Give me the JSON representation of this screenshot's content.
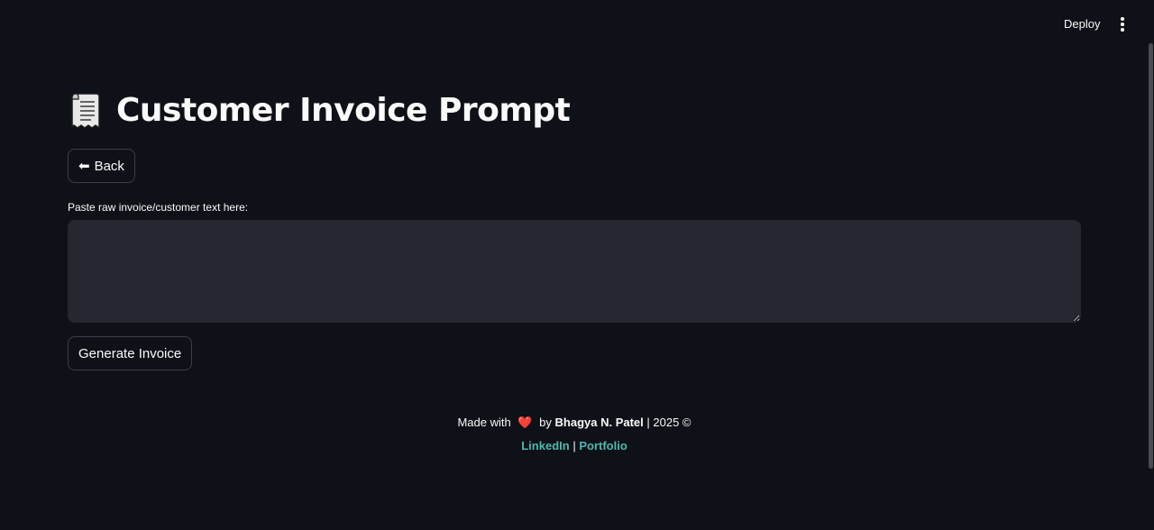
{
  "toolbar": {
    "deploy_label": "Deploy",
    "menu_icon": "more-vertical-icon"
  },
  "header": {
    "icon": "receipt-icon",
    "title": "Customer Invoice Prompt"
  },
  "back_button": {
    "arrow": "⬅",
    "label": "Back"
  },
  "invoice_input": {
    "label": "Paste raw invoice/customer text here:",
    "value": "",
    "placeholder": ""
  },
  "generate_button": {
    "label": "Generate Invoice"
  },
  "footer": {
    "made_with": "Made with",
    "heart": "❤️",
    "by": "by",
    "author": "Bhagya N. Patel",
    "year_text": "| 2025 ©",
    "links": [
      {
        "label": "LinkedIn"
      },
      {
        "label": "Portfolio"
      }
    ],
    "separator": "|"
  },
  "colors": {
    "background": "#0e1117",
    "input_bg": "#262730",
    "link": "#4fb8b0",
    "heart": "#e0413b"
  }
}
